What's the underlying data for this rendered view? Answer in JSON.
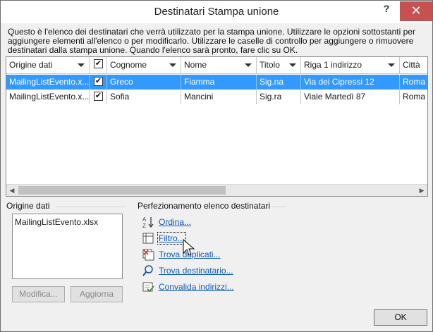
{
  "dialog": {
    "title": "Destinatari Stampa unione",
    "help_glyph": "?",
    "close_glyph": "✕",
    "description": "Questo è l'elenco dei destinatari che verrà utilizzato per la stampa unione. Utilizzare le opzioni sottostanti per aggiungere elementi all'elenco o per modificarlo. Utilizzare le caselle di controllo per aggiungere o rimuovere destinatari dalla stampa unione. Quando l'elenco sarà pronto, fare clic su OK."
  },
  "grid": {
    "columns": [
      "Origine dati",
      "",
      "Cognome",
      "Nome",
      "Titolo",
      "Riga 1 indirizzo",
      "Città"
    ],
    "rows": [
      {
        "source": "MailingListEvento.x...",
        "checked": true,
        "cognome": "Greco",
        "nome": "Fiamma",
        "titolo": "Sig.na",
        "indirizzo": "Via dei Cipressi 12",
        "citta": "Roma",
        "selected": true
      },
      {
        "source": "MailingListEvento.x...",
        "checked": true,
        "cognome": "Sofia",
        "nome": "Mancini",
        "titolo": "Sig.ra",
        "indirizzo": "Viale Martedì 87",
        "citta": "Roma",
        "selected": false
      }
    ],
    "header_checked": true
  },
  "data_source": {
    "label": "Origine dati",
    "items": [
      "MailingListEvento.xlsx"
    ],
    "edit_button": "Modifica...",
    "refresh_button": "Aggiorna"
  },
  "refine": {
    "label": "Perfezionamento elenco destinatari",
    "links": [
      {
        "label": "Ordina...",
        "icon": "sort-az-icon"
      },
      {
        "label": "Filtro...",
        "icon": "filter-icon"
      },
      {
        "label": "Trova duplicati...",
        "icon": "find-duplicates-icon"
      },
      {
        "label": "Trova destinatario...",
        "icon": "find-recipient-icon"
      },
      {
        "label": "Convalida indirizzi...",
        "icon": "validate-addresses-icon"
      }
    ]
  },
  "ok_button": "OK",
  "colors": {
    "selection": "#3399ff",
    "link": "#0b5ab8",
    "close": "#c75050"
  }
}
